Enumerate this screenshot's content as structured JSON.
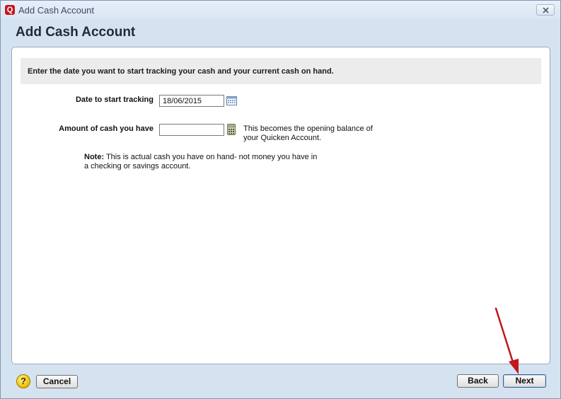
{
  "window": {
    "title": "Add Cash Account",
    "heading": "Add Cash Account",
    "app_icon_letter": "Q"
  },
  "form": {
    "instruction": "Enter the date you want to start tracking your cash and your current cash on hand.",
    "date_label": "Date to start tracking",
    "date_value": "18/06/2015",
    "amount_label": "Amount of cash you have",
    "amount_value": "",
    "amount_hint_line1": "This becomes the opening balance of",
    "amount_hint_line2": "your Quicken Account.",
    "note_label": "Note:",
    "note_line1": " This is actual cash you have on hand- not money you have in",
    "note_line2": "a checking or savings account."
  },
  "buttons": {
    "help": "?",
    "cancel": "Cancel",
    "back": "Back",
    "next": "Next"
  },
  "icons": {
    "app": "quicken-icon",
    "close": "close-icon",
    "calendar": "calendar-icon",
    "calculator": "calculator-icon",
    "help": "help-icon",
    "annotation": "arrow-annotation"
  },
  "colors": {
    "window_bg": "#d5e3f1",
    "app_icon": "#c8151b",
    "arrow": "#c0161c"
  }
}
